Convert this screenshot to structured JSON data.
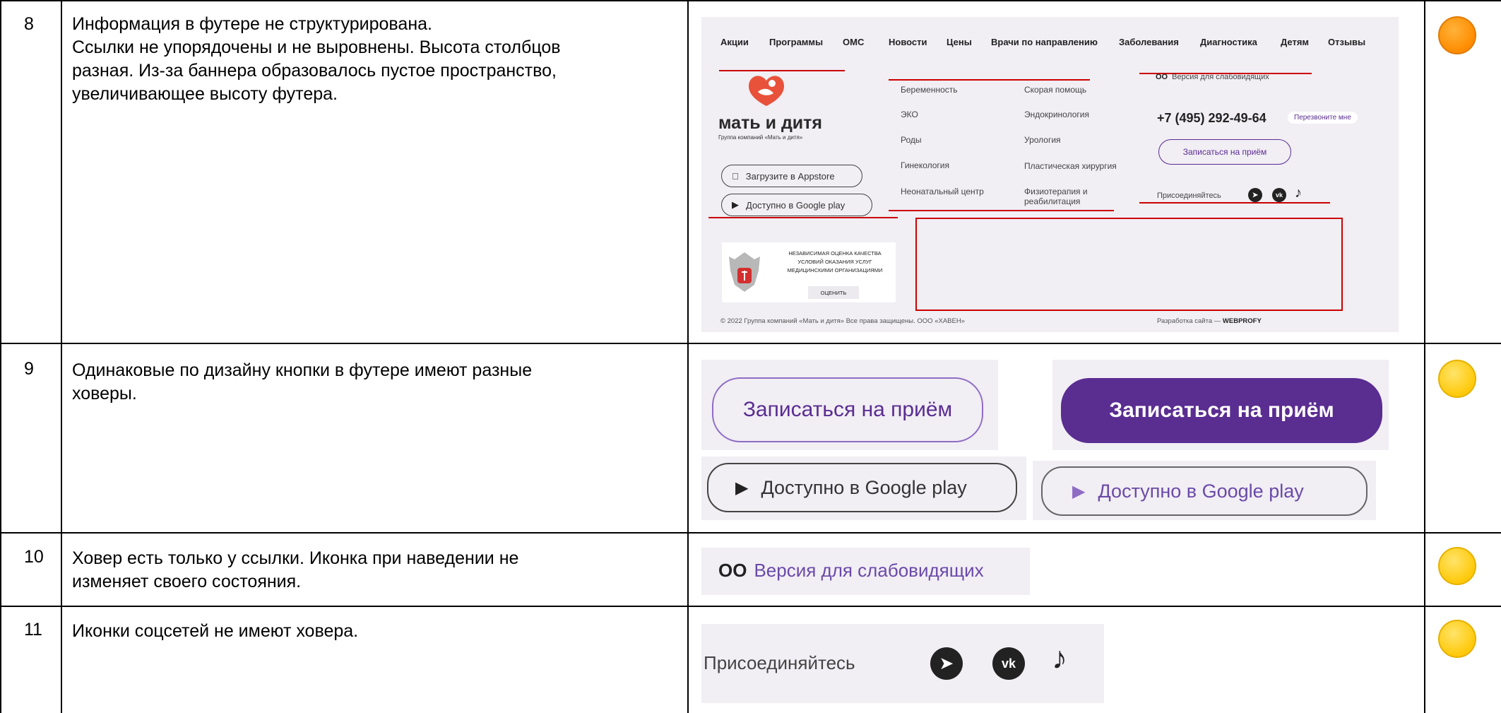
{
  "rows": [
    {
      "num": "8",
      "lines": [
        "Информация в футере не структурирована.",
        "Ссылки не упорядочены и не выровнены. Высота столбцов",
        "разная. Из-за баннера образовалось пустое пространство,",
        "увеличивающее высоту футера."
      ],
      "severity": "orange"
    },
    {
      "num": "9",
      "lines": [
        "Одинаковые по дизайну кнопки в футере имеют разные",
        "ховеры."
      ],
      "severity": "yellow"
    },
    {
      "num": "10",
      "lines": [
        "Ховер есть только у ссылки. Иконка при наведении не",
        "изменяет своего состояния."
      ],
      "severity": "yellow"
    },
    {
      "num": "11",
      "lines": [
        "Иконки соцсетей не имеют ховера."
      ],
      "severity": "yellow"
    }
  ],
  "footer": {
    "nav": [
      "Акции",
      "Программы",
      "ОМС",
      "Новости",
      "Цены",
      "Врачи по направлению",
      "Заболевания",
      "Диагностика",
      "Детям",
      "Отзывы"
    ],
    "logo_text": "мать и дитя",
    "logo_sub": "Группа компаний «Мать и дитя»",
    "appstore": "Загрузите в Appstore",
    "googleplay": "Доступно в Google play",
    "col1": [
      "Беременность",
      "ЭКО",
      "Роды",
      "Гинекология",
      "Неонатальный центр"
    ],
    "col2": [
      "Скорая помощь",
      "Эндокринология",
      "Урология",
      "Пластическая хирургия",
      "Физиотерапия и",
      "реабилитация"
    ],
    "vision": "Версия для слабовидящих",
    "phone": "+7 (495) 292-49-64",
    "callback": "Перезвоните мне",
    "appointment": "Записаться на приём",
    "join": "Присоединяйтесь",
    "banner": [
      "НЕЗАВИСИМАЯ ОЦЕНКА КАЧЕСТВА",
      "УСЛОВИЙ ОКАЗАНИЯ УСЛУГ",
      "МЕДИЦИНСКИМИ ОРГАНИЗАЦИЯМИ"
    ],
    "banner_btn": "ОЦЕНИТЬ",
    "copyright": "© 2022 Группа компаний «Мать и дитя» Все права защищены. ООО «ХАВЕН»",
    "dev_prefix": "Разработка сайта — ",
    "dev_name": "WEBPROFY"
  },
  "buttons": {
    "appointment": "Записаться на приём",
    "googleplay": "Доступно в Google play"
  },
  "vision": {
    "text": "Версия для слабовидящих"
  },
  "social": {
    "join": "Присоединяйтесь"
  },
  "colors": {
    "purple": "#5a2d91",
    "purple_light": "#8f6cc4",
    "orange": "#ff8c00",
    "yellow": "#ffc90a",
    "red_mark": "#cc0000"
  }
}
